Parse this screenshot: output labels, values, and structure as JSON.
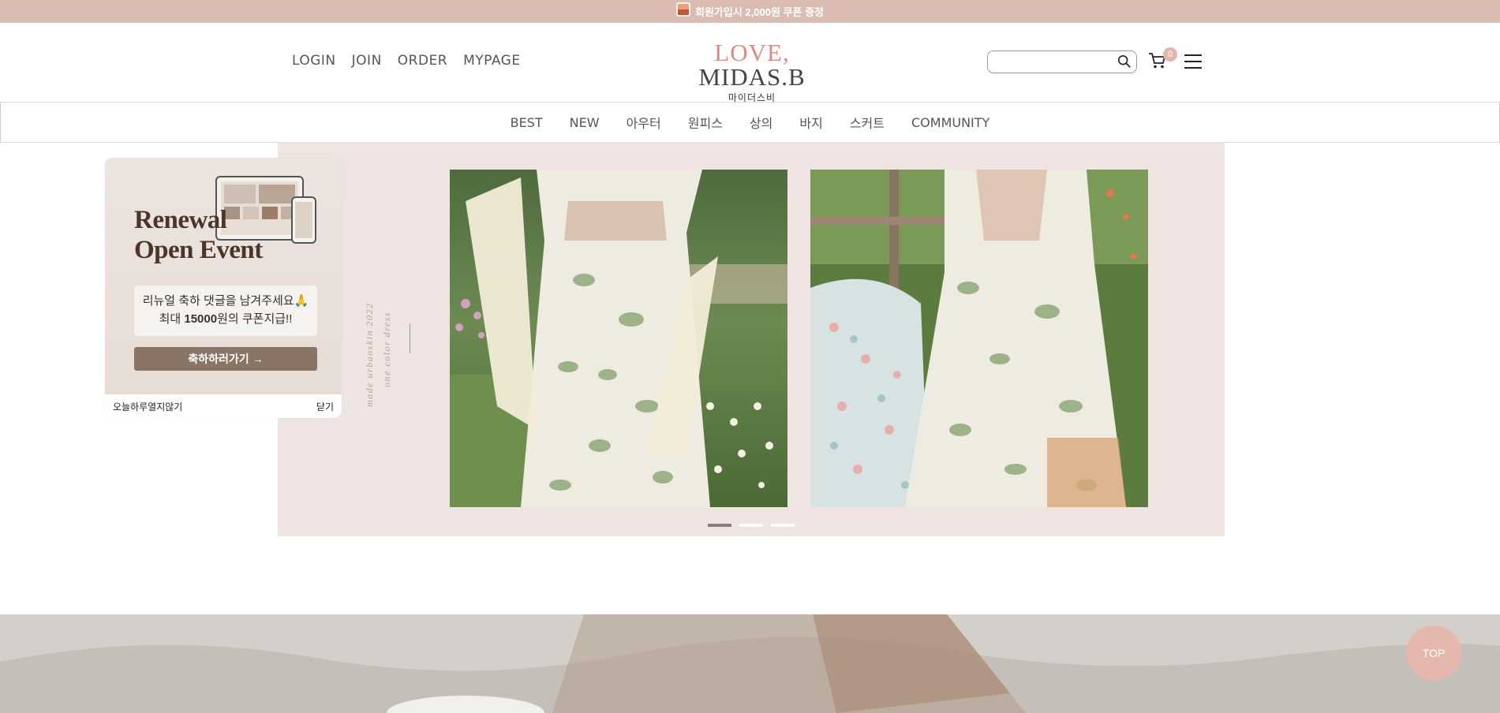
{
  "top_banner": {
    "text": "회원가입시 2,000원 쿠폰 증정",
    "icon": "gift-icon"
  },
  "header": {
    "util_links": [
      "LOGIN",
      "JOIN",
      "ORDER",
      "MYPAGE"
    ],
    "logo_love": "LOVE,",
    "logo_name": "MIDAS.B",
    "logo_sub": "마이더스비",
    "search": {
      "placeholder": "",
      "value": ""
    },
    "cart_count": "0"
  },
  "category_nav": [
    "BEST",
    "NEW",
    "아우터",
    "원피스",
    "상의",
    "바지",
    "스커트",
    "COMMUNITY"
  ],
  "hero": {
    "vertical_line1": "made urbanskin 2022",
    "vertical_line2": "one color dress",
    "slides_count": 3,
    "active_slide": 1
  },
  "popup": {
    "title_line1": "Renewal",
    "title_line2": "Open Event",
    "message_line1": "리뉴얼 축하 댓글을 남겨주세요🙏",
    "message_line2_pre": "최대 ",
    "message_line2_bold": "15000",
    "message_line2_post": "원의 쿠폰지급!!",
    "button_label": "축하하러가기 →",
    "dont_show_today": "오늘하루열지않기",
    "close_label": "닫기"
  },
  "top_button": "TOP",
  "colors": {
    "banner": "#dbbcb3",
    "accent": "#d98a82",
    "hero_bg": "#efe4e1",
    "popup_button": "#8a7466",
    "top_button": "#e6b7ad"
  }
}
